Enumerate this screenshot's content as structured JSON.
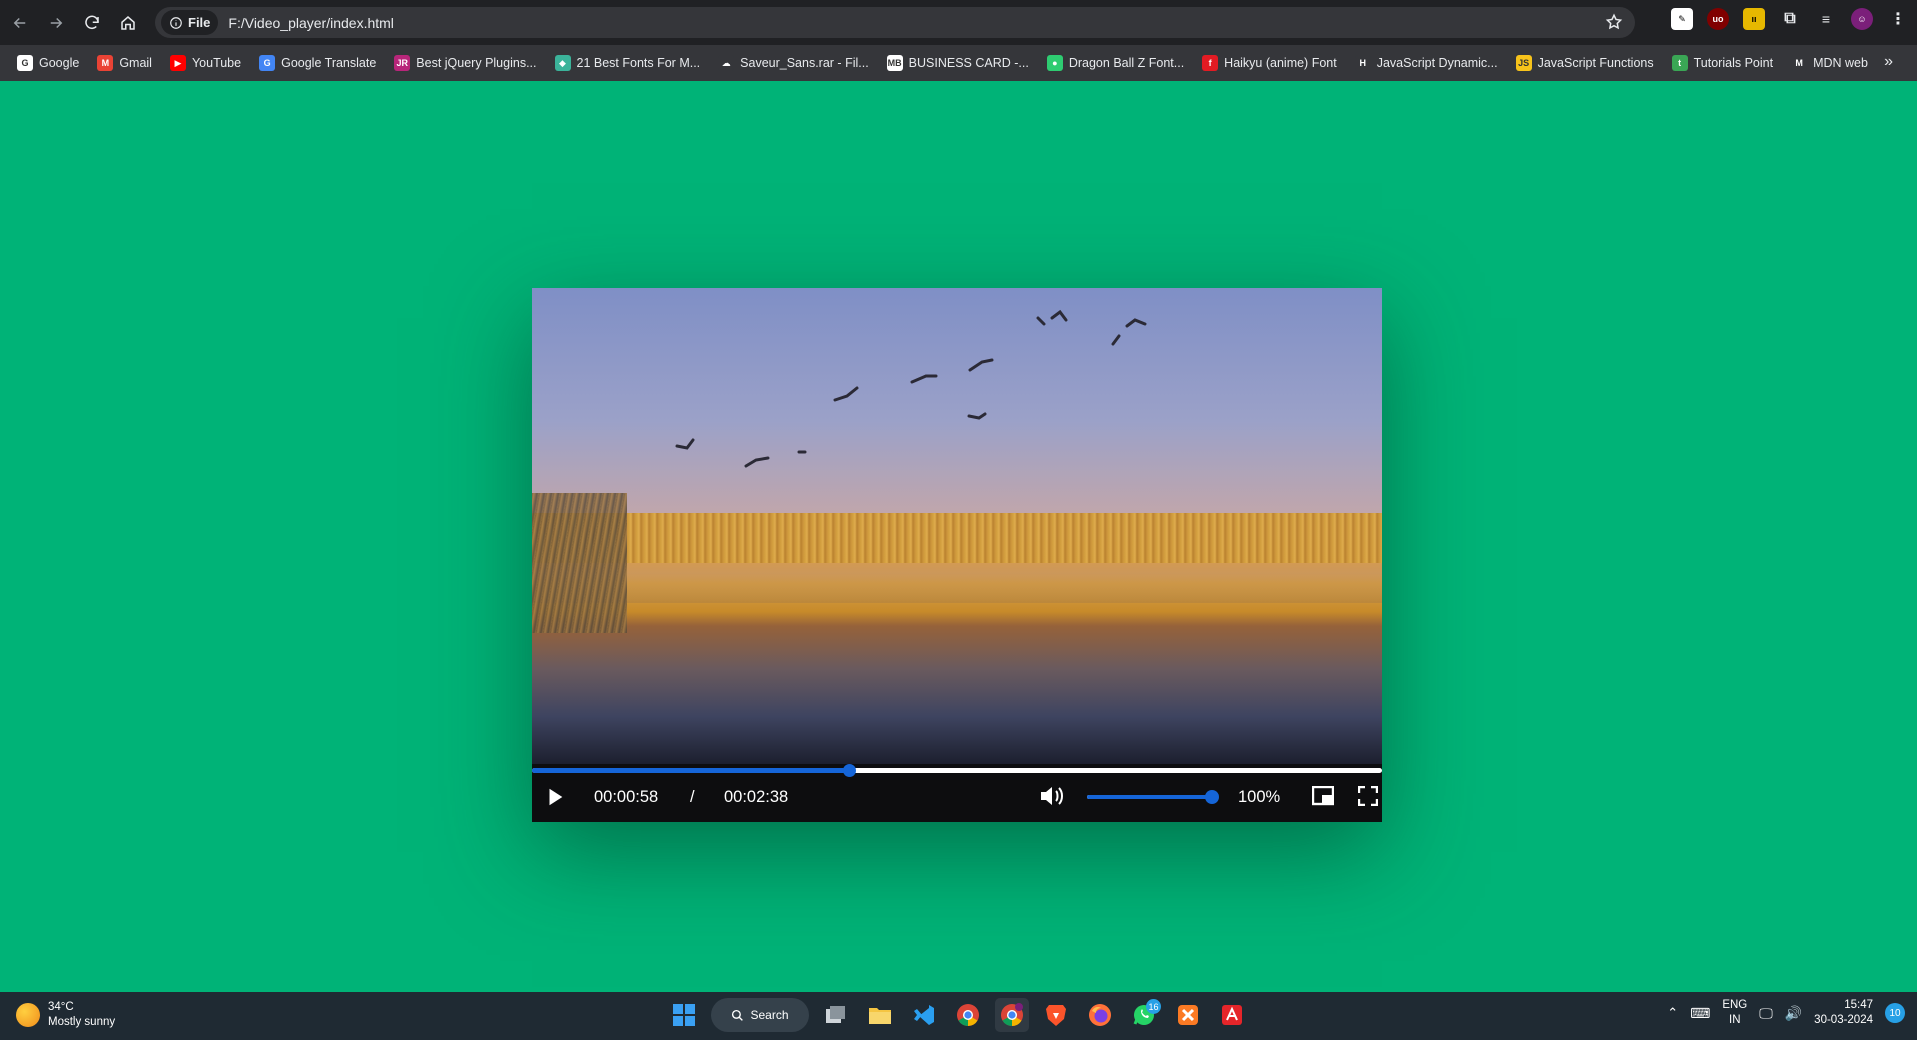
{
  "browser": {
    "address": {
      "scheme_label": "File",
      "url": "F:/Video_player/index.html"
    },
    "bookmarks": [
      {
        "label": "Google",
        "icon": "google-icon",
        "color": "#ffffff",
        "glyph": "G"
      },
      {
        "label": "Gmail",
        "icon": "gmail-icon",
        "color": "#ea4335",
        "glyph": "M"
      },
      {
        "label": "YouTube",
        "icon": "youtube-icon",
        "color": "#ff0000",
        "glyph": "▶"
      },
      {
        "label": "Google Translate",
        "icon": "translate-icon",
        "color": "#4285f4",
        "glyph": "G"
      },
      {
        "label": "Best jQuery Plugins...",
        "icon": "jquery-plugins-icon",
        "color": "#b8267a",
        "glyph": "JR"
      },
      {
        "label": "21 Best Fonts For M...",
        "icon": "tag-icon",
        "color": "#3bb39a",
        "glyph": "◆"
      },
      {
        "label": "Saveur_Sans.rar - Fil...",
        "icon": "cloud-icon",
        "color": "#35363a",
        "glyph": "☁"
      },
      {
        "label": "BUSINESS CARD -...",
        "icon": "business-card-icon",
        "color": "#ffffff",
        "glyph": "MB"
      },
      {
        "label": "Dragon Ball Z Font...",
        "icon": "dragonball-icon",
        "color": "#2ecc71",
        "glyph": "●"
      },
      {
        "label": "Haikyu (anime) Font",
        "icon": "font-f-icon",
        "color": "#e31b23",
        "glyph": "f"
      },
      {
        "label": "JavaScript Dynamic...",
        "icon": "h-icon",
        "color": "#35363a",
        "glyph": "H"
      },
      {
        "label": "JavaScript Functions",
        "icon": "js-icon",
        "color": "#f7c31b",
        "glyph": "JS"
      },
      {
        "label": "Tutorials Point",
        "icon": "tutorials-point-icon",
        "color": "#3aa655",
        "glyph": "t"
      },
      {
        "label": "MDN web",
        "icon": "mdn-icon",
        "color": "#35363a",
        "glyph": "M"
      }
    ]
  },
  "player": {
    "current_time": "00:00:58",
    "separator": "/",
    "duration": "00:02:38",
    "progress_fraction": 0.3734,
    "volume_fraction": 1.0,
    "volume_label": "100%",
    "accent_color": "#1565d8"
  },
  "taskbar": {
    "weather_temp": "34°C",
    "weather_desc": "Mostly sunny",
    "search_label": "Search",
    "whatsapp_badge": "16",
    "lang_top": "ENG",
    "lang_bottom": "IN",
    "time": "15:47",
    "date": "30-03-2024",
    "notification_count": "10"
  },
  "colors": {
    "page_background": "#00b377",
    "browser_dark": "#202124",
    "bookmark_bar": "#35363a",
    "taskbar": "#1f2a33"
  }
}
